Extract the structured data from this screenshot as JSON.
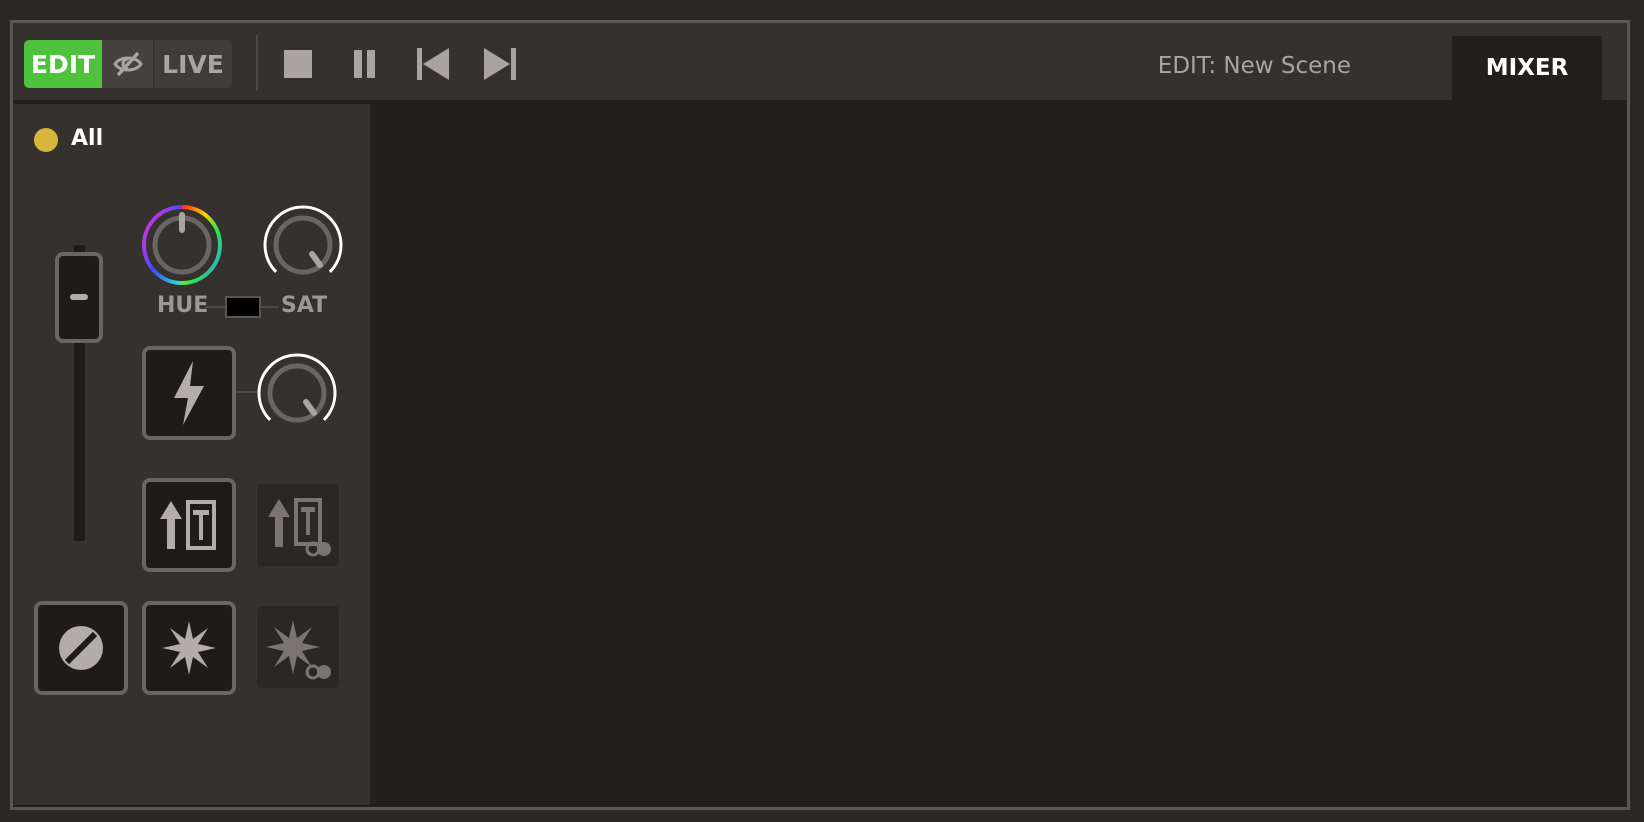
{
  "toolbar": {
    "mode_edit": "EDIT",
    "mode_live": "LIVE",
    "scene_title": "EDIT: New Scene",
    "mixer_tab": "MIXER",
    "icons": [
      "stop-icon",
      "pause-icon",
      "skip-back-icon",
      "skip-forward-icon"
    ]
  },
  "mixer": {
    "group_label": "All",
    "group_color": "#d8b53d",
    "hue_label": "HUE",
    "sat_label": "SAT"
  },
  "colors": {
    "accent": "#4ec23b",
    "background": "#221f1d",
    "panel": "#35312f"
  }
}
